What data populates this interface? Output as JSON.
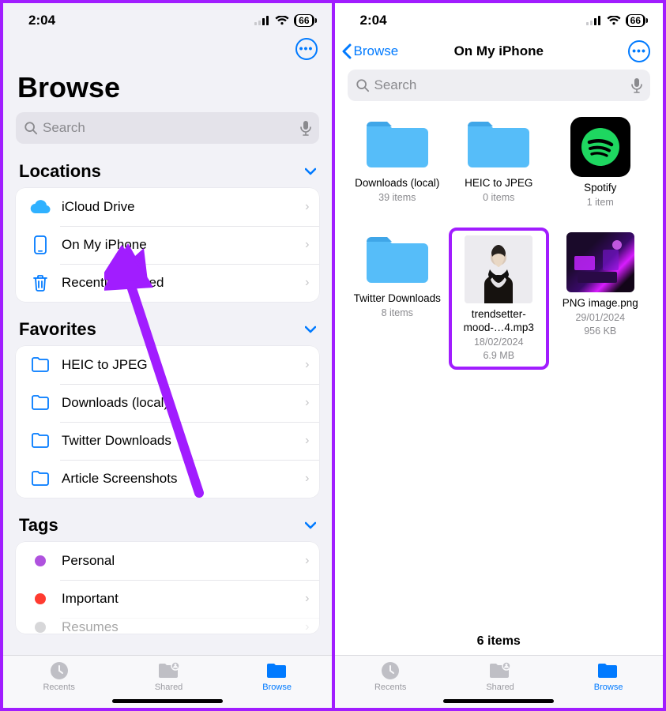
{
  "status_bar": {
    "time": "2:04",
    "battery": "66"
  },
  "screen1": {
    "title": "Browse",
    "search_placeholder": "Search",
    "sections": {
      "locations": {
        "header": "Locations",
        "items": [
          {
            "icon": "cloud",
            "label": "iCloud Drive"
          },
          {
            "icon": "phone",
            "label": "On My iPhone"
          },
          {
            "icon": "trash",
            "label": "Recently Deleted"
          }
        ]
      },
      "favorites": {
        "header": "Favorites",
        "items": [
          {
            "icon": "folder",
            "label": "HEIC to JPEG"
          },
          {
            "icon": "folder",
            "label": "Downloads (local)"
          },
          {
            "icon": "folder",
            "label": "Twitter Downloads"
          },
          {
            "icon": "folder",
            "label": "Article Screenshots"
          }
        ]
      },
      "tags": {
        "header": "Tags",
        "items": [
          {
            "color": "#af52de",
            "label": "Personal"
          },
          {
            "color": "#ff3b30",
            "label": "Important"
          },
          {
            "color": "#8e8e93",
            "label": "Resumes"
          }
        ]
      }
    },
    "tabs": {
      "recents": "Recents",
      "shared": "Shared",
      "browse": "Browse"
    }
  },
  "screen2": {
    "back_label": "Browse",
    "title": "On My iPhone",
    "search_placeholder": "Search",
    "items": [
      {
        "type": "folder",
        "name": "Downloads (local)",
        "meta1": "39 items"
      },
      {
        "type": "folder",
        "name": "HEIC to JPEG",
        "meta1": "0 items"
      },
      {
        "type": "spotify",
        "name": "Spotify",
        "meta1": "1 item"
      },
      {
        "type": "folder",
        "name": "Twitter Downloads",
        "meta1": "8 items"
      },
      {
        "type": "mp3",
        "name": "trendsetter-mood-…4.mp3",
        "meta1": "18/02/2024",
        "meta2": "6.9 MB",
        "highlighted": true
      },
      {
        "type": "png",
        "name": "PNG image.png",
        "meta1": "29/01/2024",
        "meta2": "956 KB"
      }
    ],
    "count_label": "6 items",
    "tabs": {
      "recents": "Recents",
      "shared": "Shared",
      "browse": "Browse"
    }
  }
}
